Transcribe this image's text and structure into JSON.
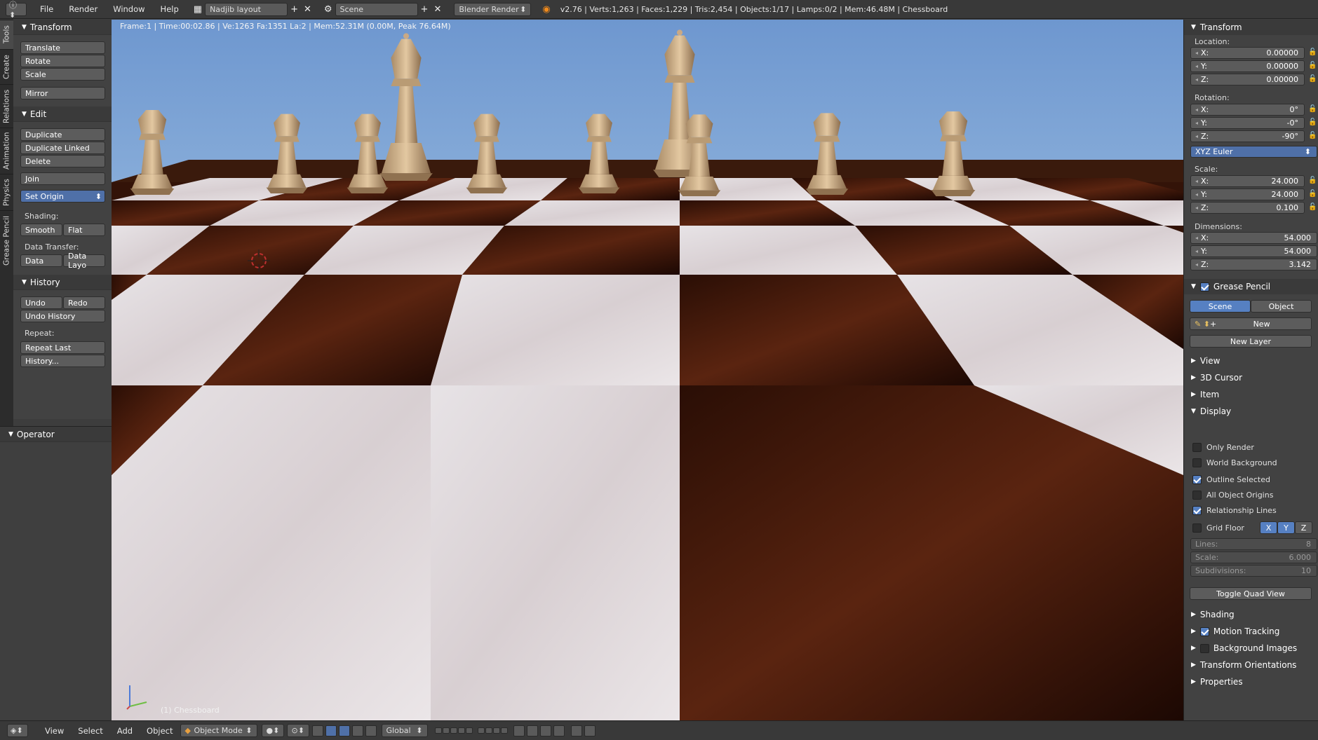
{
  "topbar": {
    "menus": [
      "File",
      "Render",
      "Window",
      "Help"
    ],
    "layout_name": "Nadjib layout",
    "scene_name": "Scene",
    "render_engine": "Blender Render",
    "stats": "v2.76 | Verts:1,263 | Faces:1,229 | Tris:2,454 | Objects:1/17 | Lamps:0/2 | Mem:46.48M | Chessboard"
  },
  "left_tabs": [
    "Tools",
    "Create",
    "Relations",
    "Animation",
    "Physics",
    "Grease Pencil"
  ],
  "toolshelf": {
    "transform": {
      "title": "Transform",
      "buttons": [
        "Translate",
        "Rotate",
        "Scale",
        "Mirror"
      ]
    },
    "edit": {
      "title": "Edit",
      "buttons": [
        "Duplicate",
        "Duplicate Linked",
        "Delete",
        "Join",
        "Set Origin"
      ],
      "shading_label": "Shading:",
      "smooth": "Smooth",
      "flat": "Flat",
      "data_transfer_label": "Data Transfer:",
      "data": "Data",
      "data_layout": "Data Layo"
    },
    "history": {
      "title": "History",
      "undo": "Undo",
      "redo": "Redo",
      "undo_history": "Undo History",
      "repeat_label": "Repeat:",
      "repeat_last": "Repeat Last",
      "history_more": "History..."
    }
  },
  "operator": {
    "title": "Operator"
  },
  "viewport": {
    "info": "Frame:1 | Time:00:02.86 | Ve:1263 Fa:1351 La:2 | Mem:52.31M (0.00M, Peak 76.64M)",
    "object_name": "(1) Chessboard"
  },
  "properties": {
    "transform_title": "Transform",
    "location_label": "Location:",
    "location": [
      {
        "axis": "X:",
        "value": "0.00000"
      },
      {
        "axis": "Y:",
        "value": "0.00000"
      },
      {
        "axis": "Z:",
        "value": "0.00000"
      }
    ],
    "rotation_label": "Rotation:",
    "rotation": [
      {
        "axis": "X:",
        "value": "0°"
      },
      {
        "axis": "Y:",
        "value": "-0°"
      },
      {
        "axis": "Z:",
        "value": "-90°"
      }
    ],
    "rotation_mode": "XYZ Euler",
    "scale_label": "Scale:",
    "scale": [
      {
        "axis": "X:",
        "value": "24.000"
      },
      {
        "axis": "Y:",
        "value": "24.000"
      },
      {
        "axis": "Z:",
        "value": "0.100"
      }
    ],
    "dimensions_label": "Dimensions:",
    "dimensions": [
      {
        "axis": "X:",
        "value": "54.000"
      },
      {
        "axis": "Y:",
        "value": "54.000"
      },
      {
        "axis": "Z:",
        "value": "3.142"
      }
    ],
    "grease_pencil": {
      "title": "Grease Pencil",
      "checked": true,
      "scene": "Scene",
      "object": "Object",
      "new": "New",
      "new_layer": "New Layer"
    },
    "collapsed_panels": [
      "View",
      "3D Cursor",
      "Item"
    ],
    "display": {
      "title": "Display",
      "checks": [
        {
          "label": "Only Render",
          "checked": false
        },
        {
          "label": "World Background",
          "checked": false
        },
        {
          "label": "Outline Selected",
          "checked": true
        },
        {
          "label": "All Object Origins",
          "checked": false
        },
        {
          "label": "Relationship Lines",
          "checked": true
        }
      ],
      "grid_floor": {
        "label": "Grid Floor",
        "checked": false,
        "axes": [
          "X",
          "Y",
          "Z"
        ]
      },
      "lines": {
        "label": "Lines:",
        "value": "8"
      },
      "grid_scale": {
        "label": "Scale:",
        "value": "6.000"
      },
      "subdivisions": {
        "label": "Subdivisions:",
        "value": "10"
      },
      "toggle_quad": "Toggle Quad View"
    },
    "bottom_panels": [
      {
        "label": "Shading",
        "checkbox": null
      },
      {
        "label": "Motion Tracking",
        "checkbox": true
      },
      {
        "label": "Background Images",
        "checkbox": false
      },
      {
        "label": "Transform Orientations",
        "checkbox": null
      },
      {
        "label": "Properties",
        "checkbox": null
      }
    ]
  },
  "bottombar": {
    "menus": [
      "View",
      "Select",
      "Add",
      "Object"
    ],
    "mode": "Object Mode",
    "orientation": "Global"
  }
}
